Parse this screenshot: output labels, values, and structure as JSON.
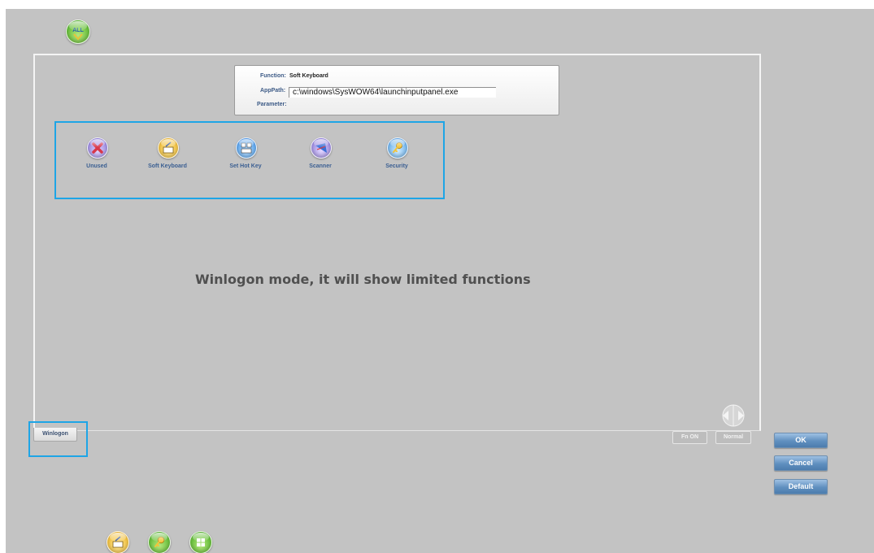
{
  "top_icon": {
    "name": "all-icon",
    "text": "ALL"
  },
  "function_box": {
    "function_label": "Function:",
    "function_value": "Soft Keyboard",
    "apppath_label": "AppPath:",
    "apppath_value": "c:\\windows\\SysWOW64\\launchinputpanel.exe",
    "parameter_label": "Parameter:"
  },
  "functions": [
    {
      "label": "Unused",
      "icon": "unused-x-icon"
    },
    {
      "label": "Soft Keyboard",
      "icon": "soft-keyboard-icon"
    },
    {
      "label": "Set Hot Key",
      "icon": "hot-key-icon"
    },
    {
      "label": "Scanner",
      "icon": "scanner-icon"
    },
    {
      "label": "Security",
      "icon": "key-icon"
    }
  ],
  "message": "Winlogon mode, it will show limited functions",
  "tab": {
    "label": "Winlogon"
  },
  "mode_buttons": {
    "fn_on": "Fn ON",
    "normal": "Normal"
  },
  "buttons": {
    "ok": "OK",
    "cancel": "Cancel",
    "default": "Default"
  },
  "taskbar_icons": [
    "soft-keyboard-icon",
    "key-icon",
    "windows-icon"
  ],
  "colors": {
    "background": "#c3c3c3",
    "highlight": "#1ea5e6",
    "button": "#5f8fbf"
  }
}
